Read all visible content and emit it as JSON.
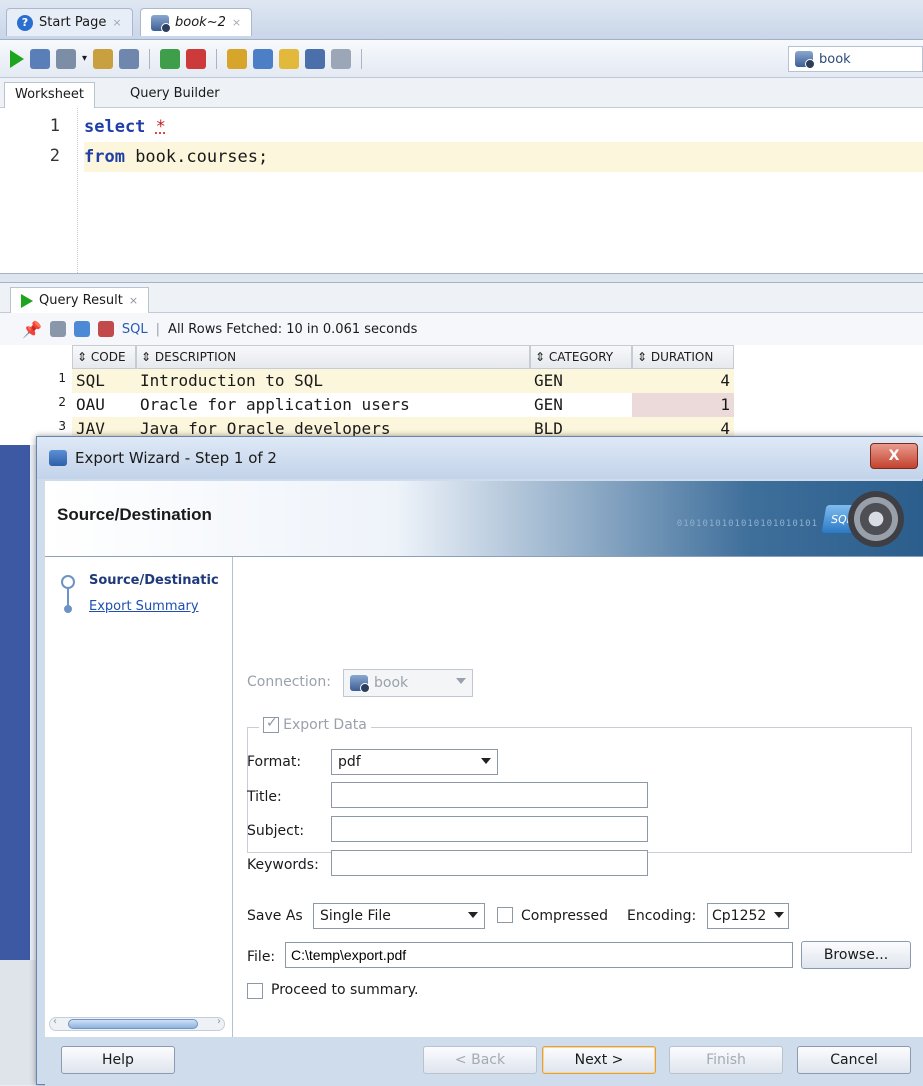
{
  "doc_tabs": [
    {
      "label": "Start Page"
    },
    {
      "label": "book~2"
    }
  ],
  "toolbar": {
    "connection": "book"
  },
  "worksheet_tabs": [
    {
      "label": "Worksheet"
    },
    {
      "label": "Query Builder"
    }
  ],
  "editor": {
    "lines": [
      {
        "num": "1",
        "kw": "select",
        "rest": "*"
      },
      {
        "num": "2",
        "kw": "from",
        "rest": " book.courses;"
      }
    ]
  },
  "results": {
    "tab_label": "Query Result",
    "sql_link": "SQL",
    "status": "All Rows Fetched: 10 in 0.061 seconds",
    "columns": [
      "CODE",
      "DESCRIPTION",
      "CATEGORY",
      "DURATION"
    ],
    "rows": [
      {
        "n": "1",
        "code": "SQL",
        "desc": "Introduction to SQL",
        "cat": "GEN",
        "dur": "4"
      },
      {
        "n": "2",
        "code": "OAU",
        "desc": "Oracle for application users",
        "cat": "GEN",
        "dur": "1"
      },
      {
        "n": "3",
        "code": "JAV",
        "desc": "Java for Oracle developers",
        "cat": "BLD",
        "dur": "4"
      }
    ]
  },
  "dialog": {
    "title": "Export Wizard - Step 1 of 2",
    "banner_title": "Source/Destination",
    "banner_binary": "0101010101010101010101",
    "banner_badge": "SQL",
    "steps": [
      {
        "label": "Source/Destinatic"
      },
      {
        "label": "Export Summary"
      }
    ],
    "connection_label": "Connection:",
    "connection_value": "book",
    "export_data_label": "Export Data",
    "format_label": "Format:",
    "format_value": "pdf",
    "title_label": "Title:",
    "title_value": "",
    "subject_label": "Subject:",
    "subject_value": "",
    "keywords_label": "Keywords:",
    "keywords_value": "",
    "save_as_label": "Save As",
    "save_as_value": "Single File",
    "compressed_label": "Compressed",
    "encoding_label": "Encoding:",
    "encoding_value": "Cp1252",
    "file_label": "File:",
    "file_value": "C:\\temp\\export.pdf",
    "browse_label": "Browse...",
    "proceed_label": "Proceed to summary.",
    "buttons": {
      "help": "Help",
      "back": "< Back",
      "next": "Next >",
      "finish": "Finish",
      "cancel": "Cancel"
    }
  }
}
